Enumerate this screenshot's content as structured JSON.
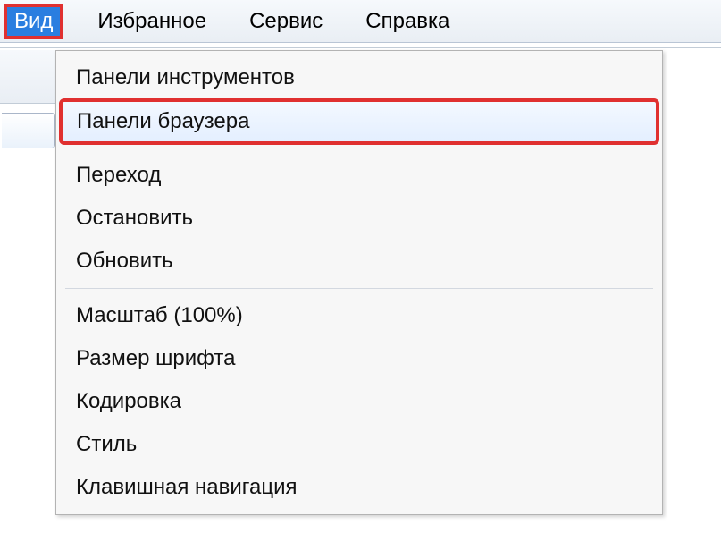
{
  "menubar": {
    "view": "Вид",
    "favorites": "Избранное",
    "tools": "Сервис",
    "help": "Справка"
  },
  "dropdown": {
    "toolbars": "Панели инструментов",
    "browser_panels": "Панели браузера",
    "go_to": "Переход",
    "stop": "Остановить",
    "refresh": "Обновить",
    "zoom": "Масштаб (100%)",
    "text_size": "Размер шрифта",
    "encoding": "Кодировка",
    "style": "Стиль",
    "caret_browsing": "Клавишная навигация"
  }
}
